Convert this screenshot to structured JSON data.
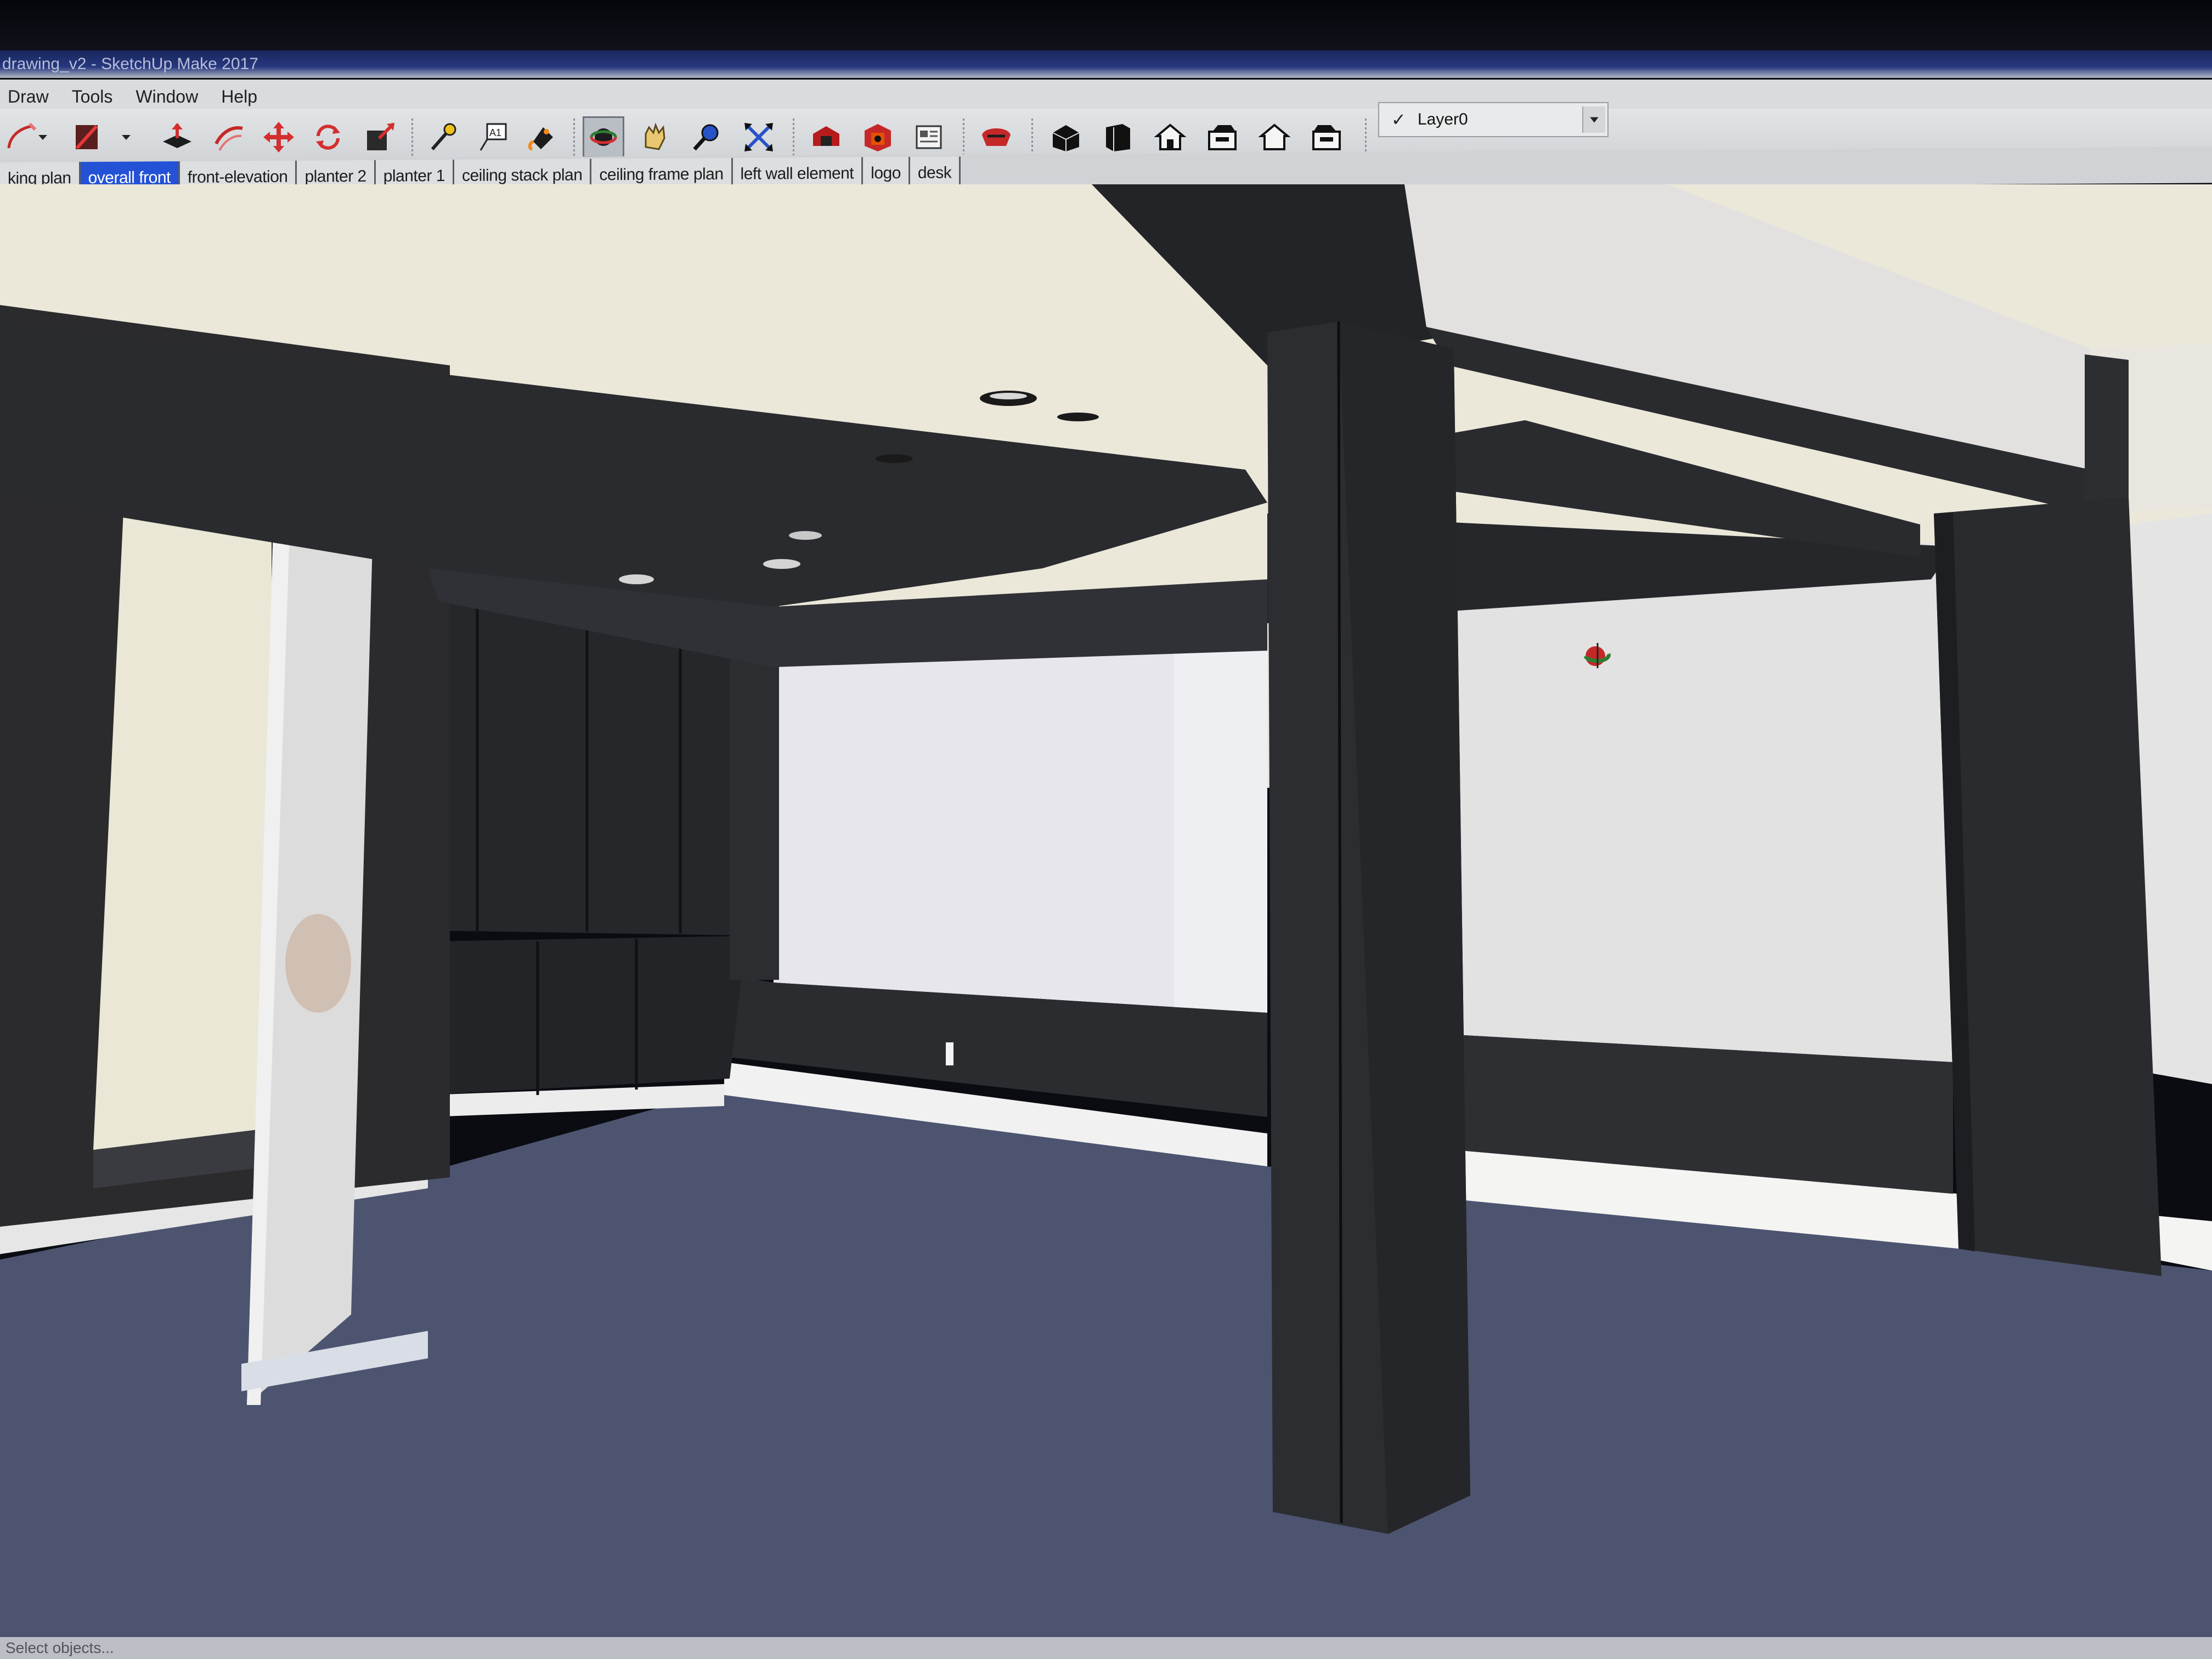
{
  "window": {
    "title": "drawing_v2 - SketchUp Make 2017"
  },
  "menu": {
    "items": [
      "Draw",
      "Tools",
      "Window",
      "Help"
    ]
  },
  "toolbar": {
    "tools": [
      {
        "icon": "pencil-icon",
        "label": "Line"
      },
      {
        "icon": "dropdown-arrow-icon",
        "label": ""
      },
      {
        "icon": "eraser-icon",
        "label": "Eraser"
      },
      {
        "icon": "dropdown-arrow-icon",
        "label": ""
      },
      {
        "icon": "push-pull-icon",
        "label": "Push/Pull"
      },
      {
        "icon": "follow-me-icon",
        "label": "Follow Me"
      },
      {
        "icon": "move-icon",
        "label": "Move"
      },
      {
        "icon": "rotate-icon",
        "label": "Rotate"
      },
      {
        "icon": "scale-icon",
        "label": "Scale"
      },
      {
        "icon": "tape-measure-icon",
        "label": "Tape Measure"
      },
      {
        "icon": "text-icon",
        "label": "Text"
      },
      {
        "icon": "paint-bucket-icon",
        "label": "Paint Bucket"
      },
      {
        "icon": "orbit-icon",
        "label": "Orbit"
      },
      {
        "icon": "pan-icon",
        "label": "Pan"
      },
      {
        "icon": "zoom-icon",
        "label": "Zoom"
      },
      {
        "icon": "zoom-extents-icon",
        "label": "Zoom Extents"
      },
      {
        "icon": "warehouse-icon",
        "label": "3D Warehouse"
      },
      {
        "icon": "components-icon",
        "label": "Components"
      },
      {
        "icon": "layout-icon",
        "label": "Send to LayOut"
      },
      {
        "icon": "extension-warehouse-icon",
        "label": "Extension Warehouse"
      },
      {
        "icon": "iso-view-icon",
        "label": "Iso"
      },
      {
        "icon": "top-view-icon",
        "label": "Top"
      },
      {
        "icon": "front-view-icon",
        "label": "Front"
      },
      {
        "icon": "right-view-icon",
        "label": "Right"
      },
      {
        "icon": "back-view-icon",
        "label": "Back"
      },
      {
        "icon": "left-view-icon",
        "label": "Left"
      }
    ]
  },
  "layers": {
    "current": "Layer0",
    "check": "✓"
  },
  "scenes": {
    "tabs": [
      {
        "label": "king plan",
        "active": false
      },
      {
        "label": "overall front",
        "active": true
      },
      {
        "label": "front-elevation",
        "active": false
      },
      {
        "label": "planter 2",
        "active": false
      },
      {
        "label": "planter 1",
        "active": false
      },
      {
        "label": "ceiling stack plan",
        "active": false
      },
      {
        "label": "ceiling frame plan",
        "active": false
      },
      {
        "label": "left wall element",
        "active": false
      },
      {
        "label": "logo",
        "active": false
      },
      {
        "label": "desk",
        "active": false
      }
    ]
  },
  "status": {
    "text": "Select objects..."
  },
  "colors": {
    "ceiling": "#ebe8da",
    "dark_structure": "#2a2b2e",
    "floor": "#4d5570",
    "wall_light": "#e3e3e3",
    "active_tab": "#2452d6"
  }
}
